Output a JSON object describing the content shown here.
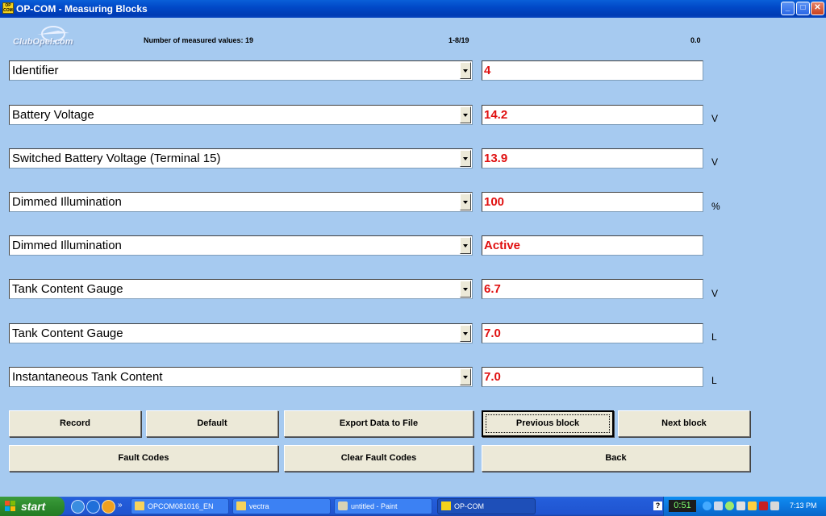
{
  "window": {
    "title": "OP-COM - Measuring Blocks",
    "icon_text": "OP COM"
  },
  "header": {
    "logo_text": "ClubOpel.com",
    "measured_label": "Number of measured values: 19",
    "page_indicator": "1-8/19",
    "timer_value": "0.0"
  },
  "rows": [
    {
      "label": "Identifier",
      "value": "4",
      "unit": ""
    },
    {
      "label": "Battery Voltage",
      "value": "14.2",
      "unit": "V"
    },
    {
      "label": "Switched Battery Voltage (Terminal 15)",
      "value": "13.9",
      "unit": "V"
    },
    {
      "label": "Dimmed Illumination",
      "value": "100",
      "unit": "%"
    },
    {
      "label": "Dimmed Illumination",
      "value": "Active",
      "unit": ""
    },
    {
      "label": "Tank Content Gauge",
      "value": "6.7",
      "unit": "V"
    },
    {
      "label": "Tank Content Gauge",
      "value": "7.0",
      "unit": "L"
    },
    {
      "label": "Instantaneous Tank Content",
      "value": "7.0",
      "unit": "L"
    }
  ],
  "buttons": {
    "record": "Record",
    "default": "Default",
    "export": "Export Data to File",
    "previous": "Previous block",
    "next": "Next block",
    "fault_codes": "Fault Codes",
    "clear_fault_codes": "Clear Fault Codes",
    "back": "Back"
  },
  "taskbar": {
    "start": "start",
    "items": [
      "OPCOM081016_EN",
      "vectra",
      "untitled - Paint",
      "OP-COM"
    ],
    "tray_readout": "0:51",
    "clock": "7:13 PM",
    "help": "?"
  },
  "colors": {
    "background": "#a6caf0",
    "value_text": "#e01010",
    "titlebar": "#0149c8",
    "taskbar": "#245edb"
  }
}
